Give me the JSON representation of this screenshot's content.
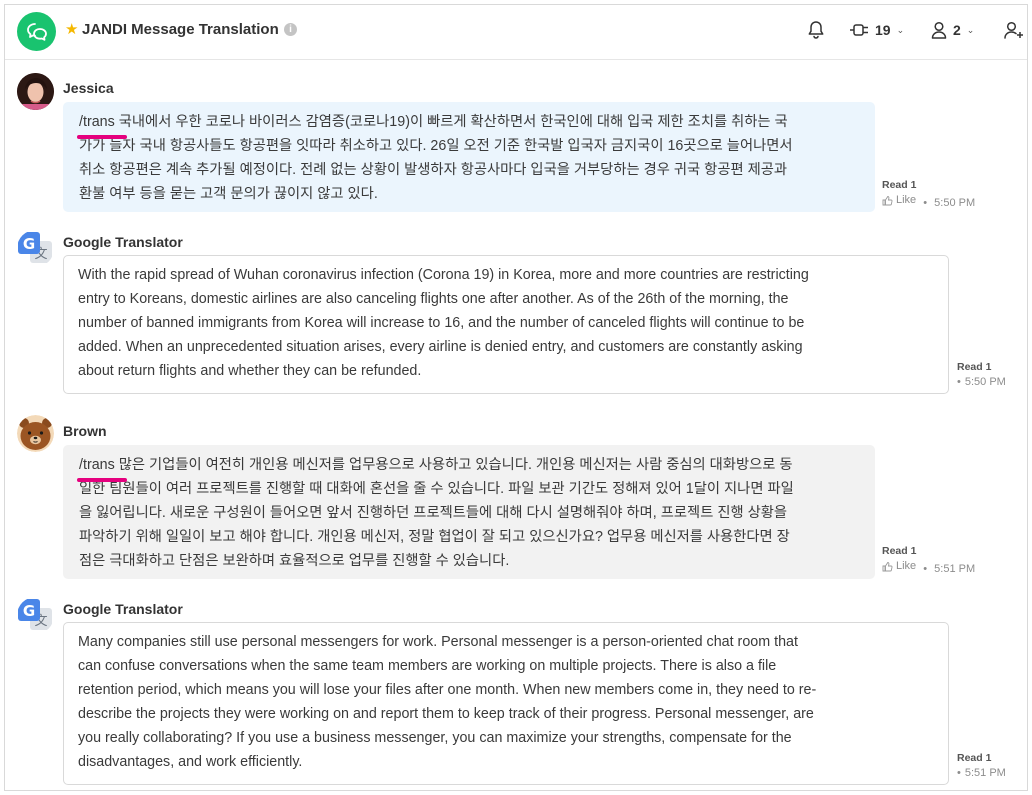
{
  "header": {
    "title": "JANDI Message Translation",
    "info_glyph": "i",
    "integrations_count": "19",
    "members_count": "2"
  },
  "messages": [
    {
      "sender": "Jessica",
      "command": "/trans",
      "lines": [
        " 국내에서 우한 코로나 바이러스 감염증(코로나19)이 빠르게 확산하면서 한국인에 대해 입국 제한 조치를 취하는 국",
        "가가 늘자 국내 항공사들도 항공편을 잇따라 취소하고 있다. 26일 오전 기준 한국발 입국자 금지국이 16곳으로 늘어나면서",
        "취소 항공편은 계속 추가될 예정이다. 전례 없는 상황이 발생하자 항공사마다 입국을 거부당하는 경우 귀국 항공편 제공과",
        "환불 여부 등을 묻는 고객 문의가 끊이지 않고 있다."
      ],
      "read": "Read 1",
      "like": "Like",
      "time": "5:50 PM"
    },
    {
      "sender": "Google Translator",
      "lines": [
        "With the rapid spread of Wuhan coronavirus infection (Corona 19) in Korea, more and more countries are restricting",
        "entry to Koreans, domestic airlines are also canceling flights one after another. As of the 26th of the morning, the",
        "number of banned immigrants from Korea will increase to 16, and the number of canceled flights will continue to be",
        "added. When an unprecedented situation arises, every airline is denied entry, and customers are constantly asking",
        "about return flights and whether they can be refunded."
      ],
      "read": "Read 1",
      "time": "5:50 PM"
    },
    {
      "sender": "Brown",
      "command": "/trans",
      "lines": [
        " 많은 기업들이 여전히 개인용 메신저를 업무용으로 사용하고 있습니다. 개인용 메신저는 사람 중심의 대화방으로 동",
        "일한 팀원들이 여러 프로젝트를 진행할 때 대화에 혼선을 줄 수 있습니다. 파일 보관 기간도 정해져 있어 1달이 지나면 파일",
        "을 잃어립니다. 새로운 구성원이 들어오면 앞서 진행하던 프로젝트들에 대해 다시 설명해줘야 하며, 프로젝트 진행 상황을",
        "파악하기 위해 일일이 보고 해야 합니다. 개인용 메신저, 정말 협업이 잘 되고 있으신가요? 업무용 메신저를 사용한다면 장",
        "점은 극대화하고 단점은 보완하며 효율적으로 업무를 진행할 수 있습니다."
      ],
      "read": "Read 1",
      "like": "Like",
      "time": "5:51 PM"
    },
    {
      "sender": "Google Translator",
      "lines": [
        "Many companies still use personal messengers for work. Personal messenger is a person-oriented chat room that",
        "can confuse conversations when the same team members are working on multiple projects. There is also a file",
        "retention period, which means you will lose your files after one month. When new members come in, they need to re-",
        "describe the projects they were working on and report them to keep track of their progress. Personal messenger, are",
        "you really collaborating? If you use a business messenger, you can maximize your strengths, compensate for the",
        "disadvantages, and work efficiently."
      ],
      "read": "Read 1",
      "time": "5:51 PM"
    }
  ],
  "colors": {
    "brand_green": "#19c36f",
    "command_underline": "#e5007e",
    "own_bubble": "#ebf5fd",
    "other_bubble": "#f2f2f2",
    "star": "#f5b800"
  },
  "icons": [
    "chat-bubbles-icon",
    "star-icon",
    "info-icon",
    "bell-icon",
    "plug-icon",
    "user-icon",
    "add-user-icon",
    "thumbs-up-icon",
    "google-translate-icon"
  ]
}
